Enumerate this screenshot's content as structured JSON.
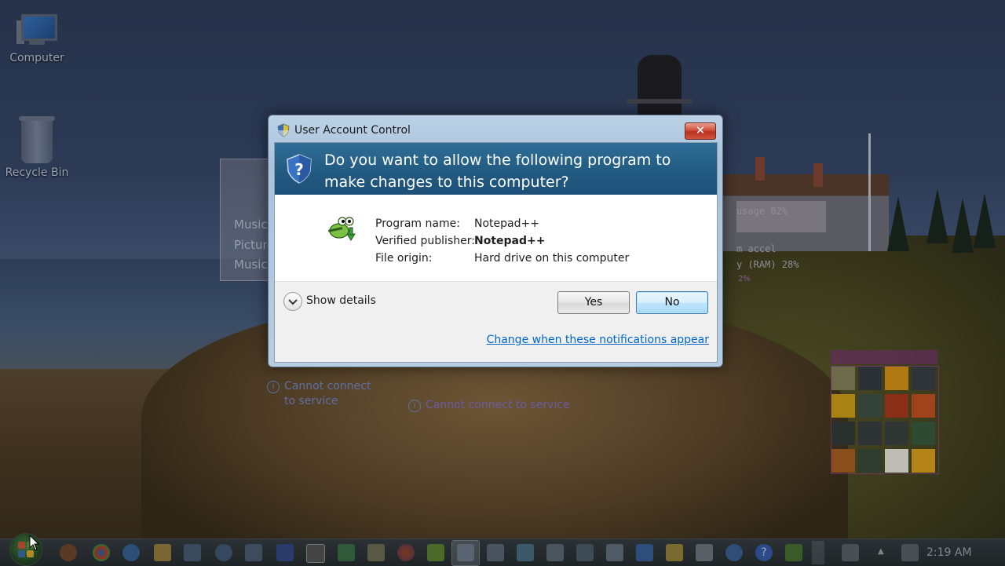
{
  "desktop": {
    "icons": [
      {
        "label": "Computer"
      },
      {
        "label": "Recycle Bin"
      }
    ],
    "gadget_menu": [
      "Music",
      "Pictures",
      "Music"
    ],
    "gadget_meter": [
      "usage 02%",
      "m accel",
      "y (RAM) 28%",
      "2%"
    ],
    "notices": [
      "Cannot connect",
      "to service",
      "Cannot connect to service"
    ]
  },
  "dialog": {
    "title": "User Account Control",
    "close_glyph": "✕",
    "question": "Do you want to allow the following program to make changes to this computer?",
    "details": [
      {
        "label": "Program name:",
        "value": "Notepad++"
      },
      {
        "label": "Verified publisher:",
        "value": "Notepad++"
      },
      {
        "label": "File origin:",
        "value": "Hard drive on this computer"
      }
    ],
    "show_details": "Show details",
    "yes_label": "Yes",
    "no_label": "No",
    "change_link": "Change when these notifications appear"
  },
  "taskbar": {
    "clock": "2:19 AM",
    "icons": [
      "windows-orb",
      "media-player",
      "chrome",
      "internet-explorer",
      "folder",
      "network",
      "app",
      "app",
      "7zip",
      "app",
      "app",
      "firefox",
      "notepad",
      "active-window",
      "app",
      "app",
      "app",
      "app",
      "app",
      "folder",
      "app",
      "app",
      "help",
      "app",
      "pen",
      "flag",
      "volume"
    ]
  },
  "colors": {
    "banner": "#22597f",
    "link": "#0066cc",
    "close": "#c63f2a"
  }
}
